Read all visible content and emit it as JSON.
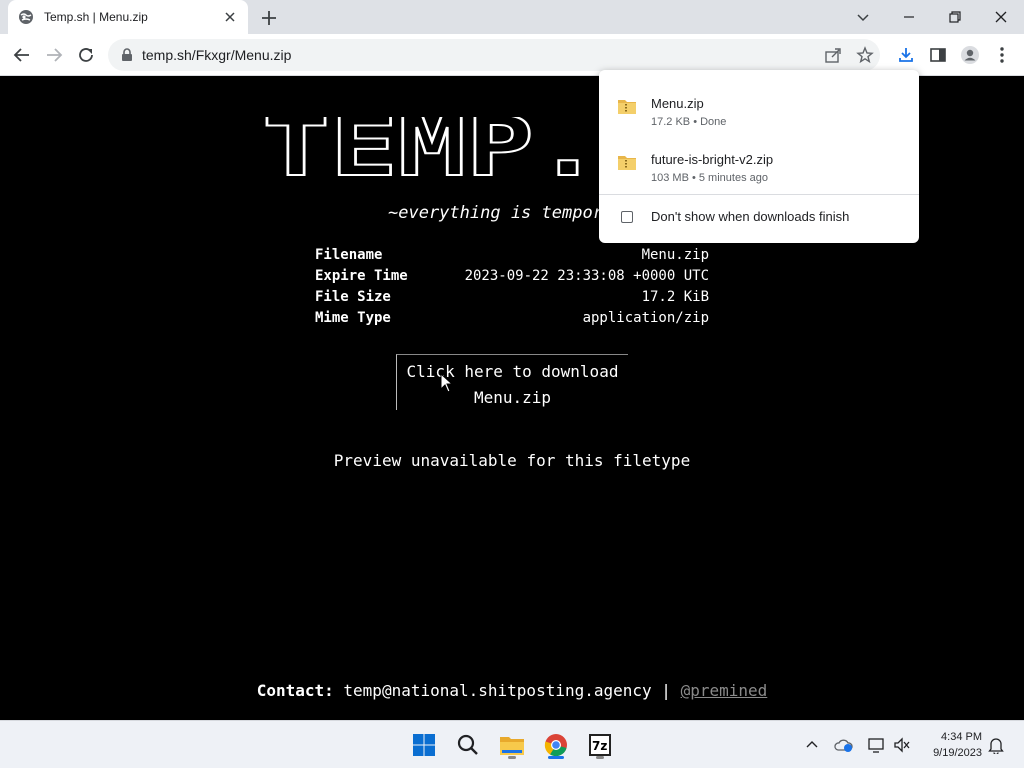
{
  "browser": {
    "tab": {
      "title": "Temp.sh | Menu.zip",
      "favicon": "globe-icon"
    },
    "address": "temp.sh/Fkxgr/Menu.zip"
  },
  "page": {
    "logo_text": "TEMP.",
    "tagline": "~everything is tempora",
    "info": [
      {
        "key": "Filename",
        "value": "Menu.zip"
      },
      {
        "key": "Expire Time",
        "value": "2023-09-22 23:33:08 +0000 UTC"
      },
      {
        "key": "File Size",
        "value": "17.2 KiB"
      },
      {
        "key": "Mime Type",
        "value": "application/zip"
      }
    ],
    "download_link": {
      "line1": "Click here to download",
      "line2": "Menu.zip"
    },
    "preview_text": "Preview unavailable for this filetype",
    "contact": {
      "label": "Contact:",
      "email": "temp@national.shitposting.agency",
      "separator": "|",
      "handle": "@premined"
    }
  },
  "downloads_popup": {
    "items": [
      {
        "name": "Menu.zip",
        "status": "17.2 KB • Done"
      },
      {
        "name": "future-is-bright-v2.zip",
        "status": "103 MB • 5 minutes ago"
      }
    ],
    "checkbox_label": "Don't show when downloads finish"
  },
  "taskbar": {
    "time": "4:34 PM",
    "date": "9/19/2023"
  }
}
